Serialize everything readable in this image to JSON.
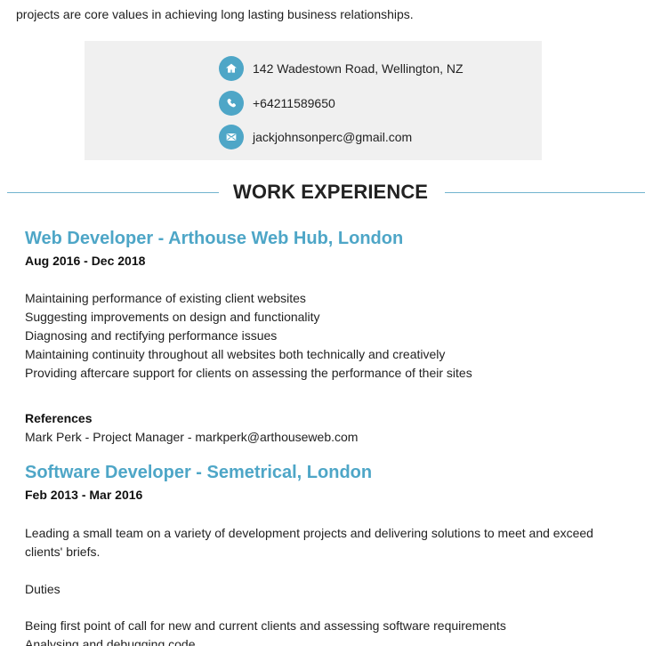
{
  "intro": {
    "text": "projects are core values in achieving long lasting business relationships."
  },
  "contact": {
    "address": "142 Wadestown Road, Wellington, NZ",
    "phone": "+64211589650",
    "email": "jackjohnsonperc@gmail.com",
    "icons": [
      "home-icon",
      "phone-icon",
      "email-icon"
    ],
    "accent_color": "#4ea6c7"
  },
  "section": {
    "title": "WORK EXPERIENCE"
  },
  "jobs": [
    {
      "title": "Web Developer - Arthouse Web Hub, London",
      "dates": "Aug 2016 - Dec 2018",
      "lines": [
        "Maintaining performance of existing client websites",
        "Suggesting improvements on design and functionality",
        "Diagnosing and rectifying performance issues",
        "Maintaining continuity throughout all websites both technically and creatively",
        "Providing aftercare support for clients on assessing the performance of their sites"
      ],
      "references_label": "References",
      "references_text": "Mark Perk - Project Manager - markperk@arthouseweb.com"
    },
    {
      "title": "Software Developer - Semetrical, London",
      "dates": "Feb 2013 - Mar 2016",
      "summary_line_1": "Leading a small team on a variety of development projects and delivering solutions to meet and exceed",
      "summary_line_2": "clients' briefs.",
      "duties_label": "Duties",
      "lines": [
        "Being first point of call for new and current clients and assessing software requirements",
        "Analysing and debugging code"
      ]
    }
  ]
}
